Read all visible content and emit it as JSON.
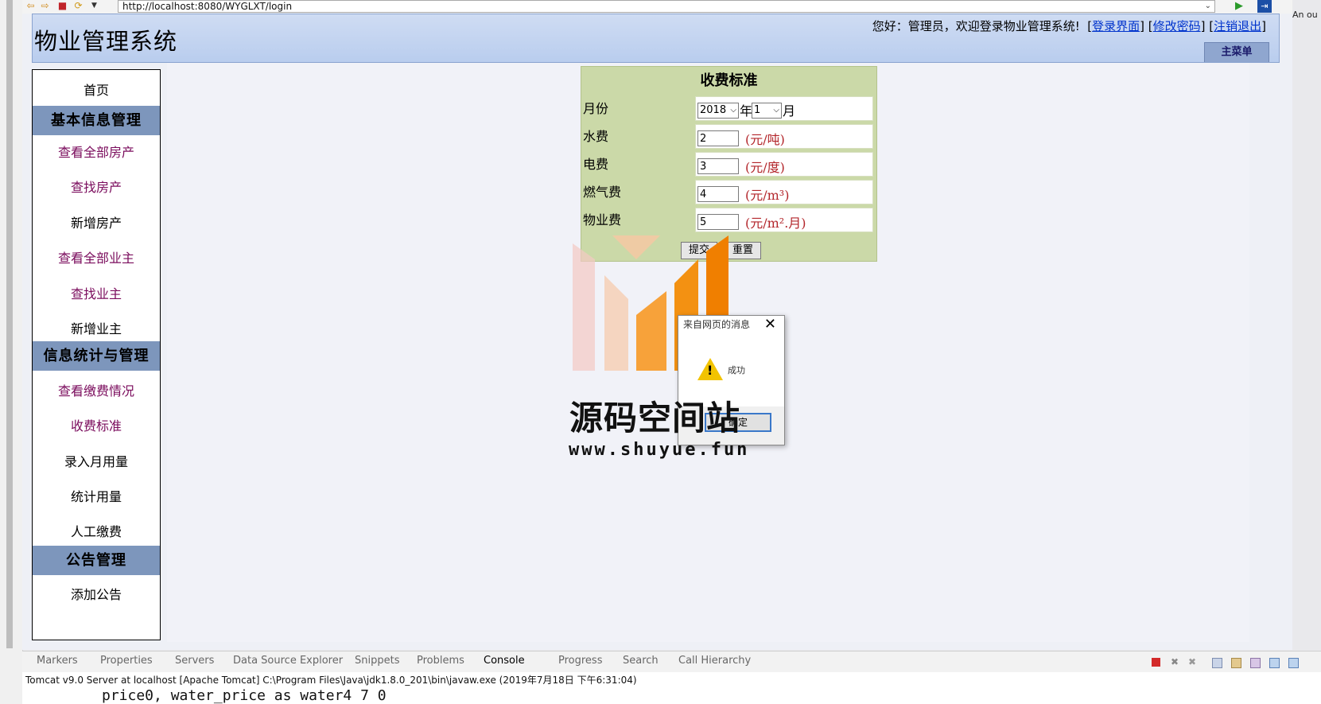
{
  "browser": {
    "url": "http://localhost:8080/WYGLXT/login",
    "side_note": "An ou"
  },
  "header": {
    "title": "物业管理系统",
    "welcome": "您好：管理员，欢迎登录物业管理系统!",
    "link_login": "登录界面",
    "link_password": "修改密码",
    "link_logout": "注销退出",
    "menu_tab": "主菜单"
  },
  "sidebar": {
    "home": "首页",
    "sec_basic": "基本信息管理",
    "view_all_property": "查看全部房产",
    "find_property": "查找房产",
    "add_property": "新增房产",
    "view_all_owner": "查看全部业主",
    "find_owner": "查找业主",
    "add_owner": "新增业主",
    "sec_stats": "信息统计与管理",
    "view_payment": "查看缴费情况",
    "fee_standard": "收费标准",
    "enter_usage": "录入月用量",
    "usage_stats": "统计用量",
    "manual_pay": "人工缴费",
    "sec_notice": "公告管理",
    "add_notice": "添加公告"
  },
  "form": {
    "title": "收费标准",
    "month_label": "月份",
    "year_value": "2018",
    "year_suffix": "年",
    "month_value": "1",
    "month_suffix": "月",
    "water_label": "水费",
    "water_value": "2",
    "water_unit": "(元/吨)",
    "elec_label": "电费",
    "elec_value": "3",
    "elec_unit": "(元/度)",
    "gas_label": "燃气费",
    "gas_value": "4",
    "gas_unit": "(元/m³)",
    "property_label": "物业费",
    "property_value": "5",
    "property_unit": "(元/m².月)",
    "submit": "提交",
    "reset": "重置"
  },
  "dialog": {
    "title": "来自网页的消息",
    "message": "成功",
    "ok": "确定"
  },
  "watermark": {
    "text": "源码空间站",
    "url": "www.shuyue.fun"
  },
  "bottom": {
    "tabs": [
      "Markers",
      "Properties",
      "Servers",
      "Data Source Explorer",
      "Snippets",
      "Problems",
      "Console",
      "Progress",
      "Search",
      "Call Hierarchy"
    ],
    "console_header": "Tomcat v9.0 Server at localhost [Apache Tomcat] C:\\Program Files\\Java\\jdk1.8.0_201\\bin\\javaw.exe (2019年7月18日 下午6:31:04)",
    "console_output": "price0, water_price as water4 7 0"
  }
}
